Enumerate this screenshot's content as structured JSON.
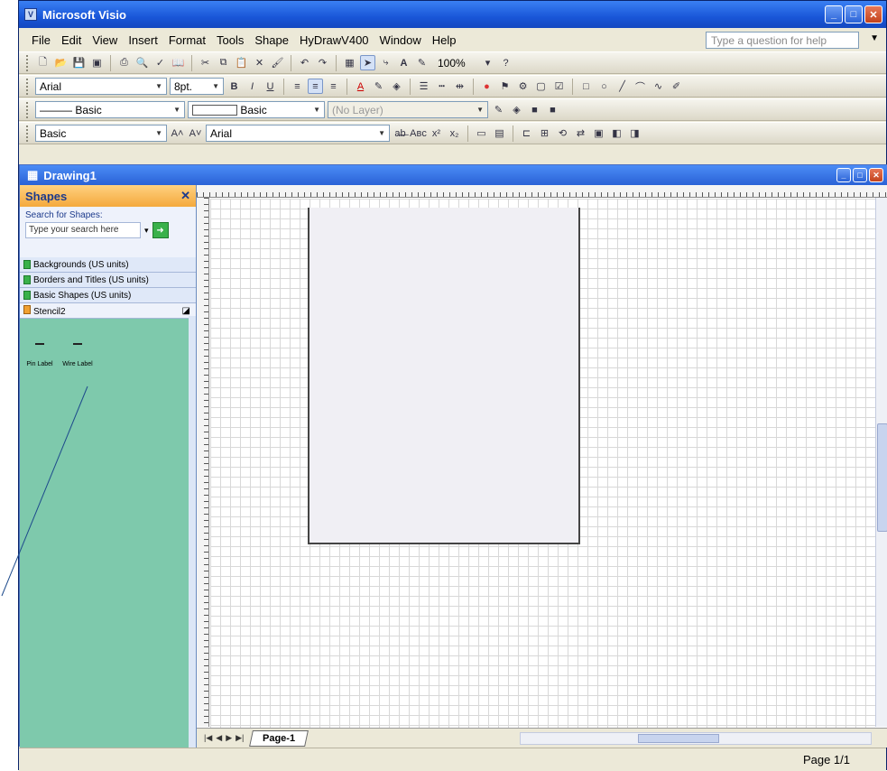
{
  "app": {
    "title": "Microsoft Visio"
  },
  "menu": [
    "File",
    "Edit",
    "View",
    "Insert",
    "Format",
    "Tools",
    "Shape",
    "HyDrawV400",
    "Window",
    "Help"
  ],
  "help": {
    "placeholder": "Type a question for help"
  },
  "toolbar1": {
    "zoom": "100%"
  },
  "format_bar": {
    "font": "Arial",
    "size": "8pt."
  },
  "line_bar": {
    "line_style": "Basic",
    "fill_style": "Basic",
    "layer": "(No Layer)"
  },
  "text_bar": {
    "style": "Basic",
    "font": "Arial"
  },
  "document": {
    "title": "Drawing1"
  },
  "shapes_panel": {
    "title": "Shapes",
    "search_label": "Search for Shapes:",
    "search_placeholder": "Type your search here",
    "stencils": [
      "Backgrounds (US units)",
      "Borders and Titles (US units)",
      "Basic Shapes (US units)",
      "Stencil2"
    ],
    "masters": [
      "Pin Label",
      "Wire Label"
    ]
  },
  "page_tabs": {
    "active": "Page-1"
  },
  "status": {
    "page": "Page 1/1"
  }
}
